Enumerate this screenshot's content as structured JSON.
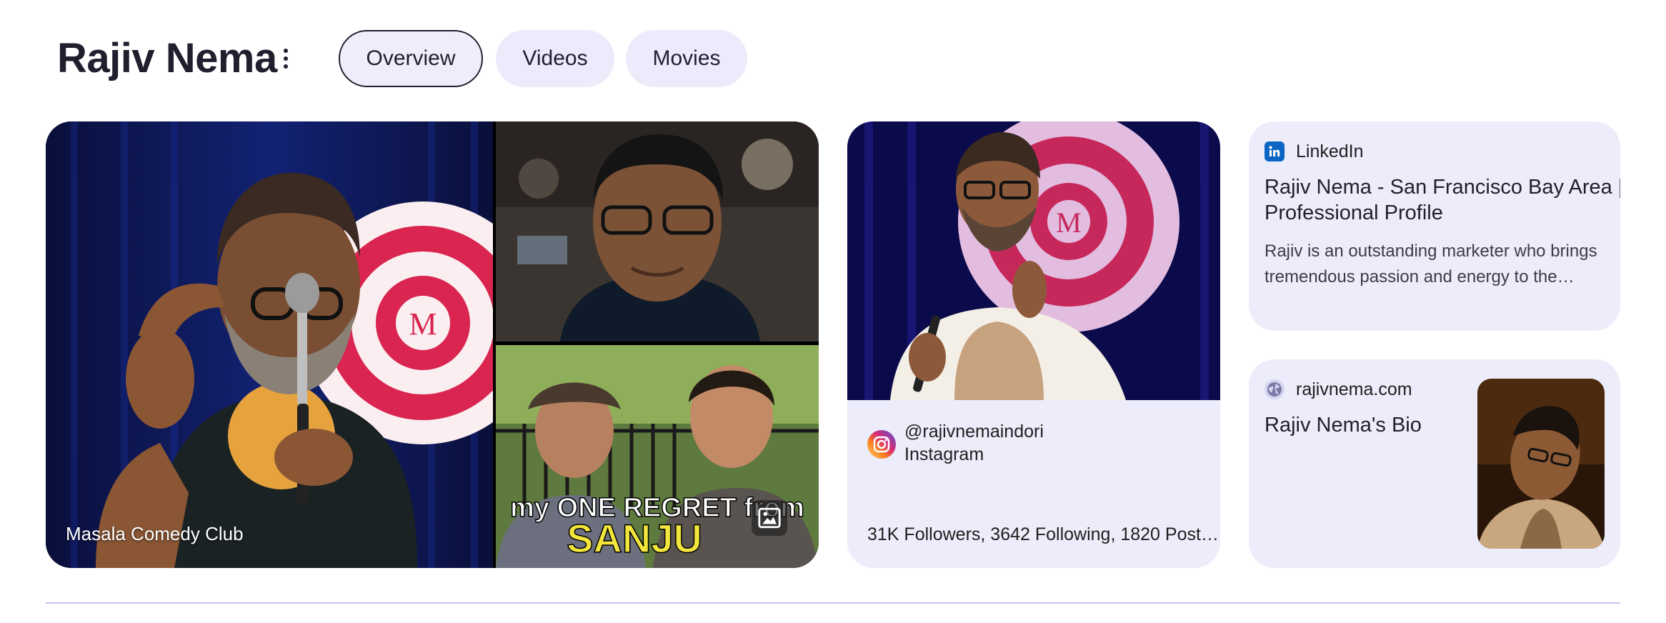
{
  "header": {
    "title": "Rajiv Nema",
    "tabs": [
      {
        "label": "Overview",
        "active": true
      },
      {
        "label": "Videos",
        "active": false
      },
      {
        "label": "Movies",
        "active": false
      }
    ]
  },
  "images": {
    "main_caption": "Masala Comedy Club",
    "overlay_text_line1": "my ONE REGRET from",
    "overlay_text_line2": "SANJU",
    "logo_letter": "M"
  },
  "instagram": {
    "handle": "@rajivnemaindori",
    "source": "Instagram",
    "stats": "31K Followers, 3642 Following, 1820 Post…",
    "logo_letter": "M"
  },
  "linkedin": {
    "source": "LinkedIn",
    "title_line1": "Rajiv Nema - San Francisco Bay Area |",
    "title_line2": "Professional Profile",
    "snippet_line1": "Rajiv is an outstanding marketer who brings",
    "snippet_line2": "tremendous passion and energy to the…"
  },
  "website": {
    "source": "rajivnema.com",
    "title": "Rajiv Nema's Bio"
  },
  "colors": {
    "chip_bg": "#ecebfb",
    "card_bg": "#ececfb",
    "title_text": "#1f1f2e",
    "linkedin_blue": "#0a66c2",
    "brand_red": "#d9254f"
  },
  "icons": [
    "more-vert-icon",
    "image-icon",
    "instagram-icon",
    "linkedin-icon",
    "globe-icon"
  ]
}
